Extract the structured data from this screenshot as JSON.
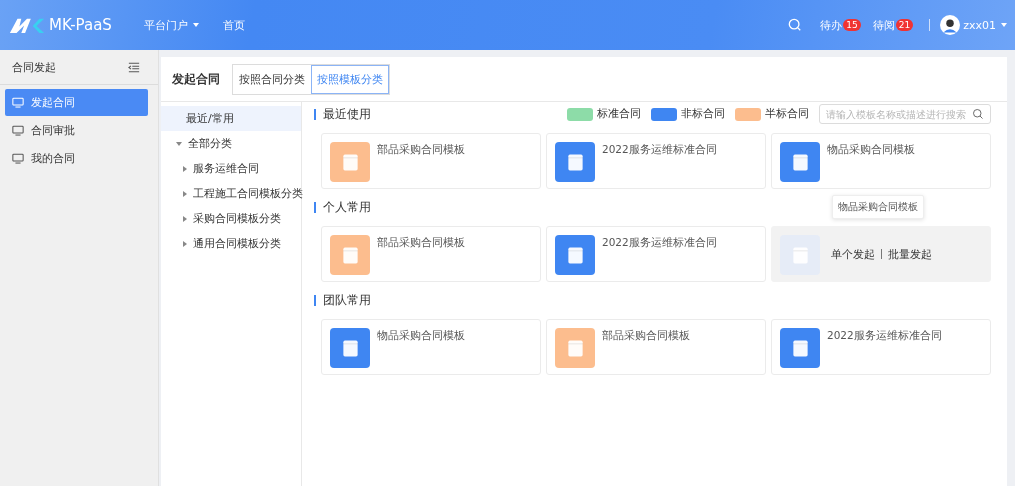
{
  "header": {
    "brand": "MK-PaaS",
    "nav": [
      {
        "label": "平台门户",
        "dropdown": true
      },
      {
        "label": "首页",
        "dropdown": false
      }
    ],
    "todo": {
      "label": "待办",
      "count": "15"
    },
    "toread": {
      "label": "待阅",
      "count": "21"
    },
    "user": "zxx01"
  },
  "sidebar": {
    "title": "合同发起",
    "items": [
      {
        "label": "发起合同",
        "selected": true
      },
      {
        "label": "合同审批",
        "selected": false
      },
      {
        "label": "我的合同",
        "selected": false
      }
    ]
  },
  "page": {
    "title": "发起合同",
    "tabs": [
      {
        "label": "按照合同分类",
        "selected": false
      },
      {
        "label": "按照模板分类",
        "selected": true
      }
    ]
  },
  "tree": [
    {
      "label": "最近/常用",
      "selected": true
    },
    {
      "label": "全部分类",
      "selected": false,
      "expanded": true,
      "children": [
        {
          "label": "服务运维合同",
          "selected": false
        },
        {
          "label": "工程施工合同模板分类",
          "selected": false
        },
        {
          "label": "采购合同模板分类",
          "selected": false
        },
        {
          "label": "通用合同模板分类",
          "selected": false
        }
      ]
    }
  ],
  "legend": [
    {
      "label": "标准合同",
      "color": "#8ddca8"
    },
    {
      "label": "非标合同",
      "color": "#3f86f2"
    },
    {
      "label": "半标合同",
      "color": "#fcbd8e"
    }
  ],
  "search": {
    "placeholder": "请输入模板名称或描述进行搜索"
  },
  "sections": [
    {
      "title": "最近使用",
      "cards": [
        {
          "name": "部品采购合同模板",
          "color": "#fcbd8e"
        },
        {
          "name": "2022服务运维标准合同",
          "color": "#3f86f2"
        },
        {
          "name": "物品采购合同模板",
          "color": "#3f86f2"
        }
      ]
    },
    {
      "title": "个人常用",
      "cards": [
        {
          "name": "部品采购合同模板",
          "color": "#fcbd8e"
        },
        {
          "name": "2022服务运维标准合同",
          "color": "#3f86f2"
        },
        {
          "color": "#e6ecf7",
          "hovered": true,
          "tooltip": "物品采购合同模板",
          "actions": [
            "单个发起",
            "批量发起"
          ]
        }
      ]
    },
    {
      "title": "团队常用",
      "cards": [
        {
          "name": "物品采购合同模板",
          "color": "#3f86f2"
        },
        {
          "name": "部品采购合同模板",
          "color": "#fcbd8e"
        },
        {
          "name": "2022服务运维标准合同",
          "color": "#3f86f2"
        }
      ]
    }
  ]
}
